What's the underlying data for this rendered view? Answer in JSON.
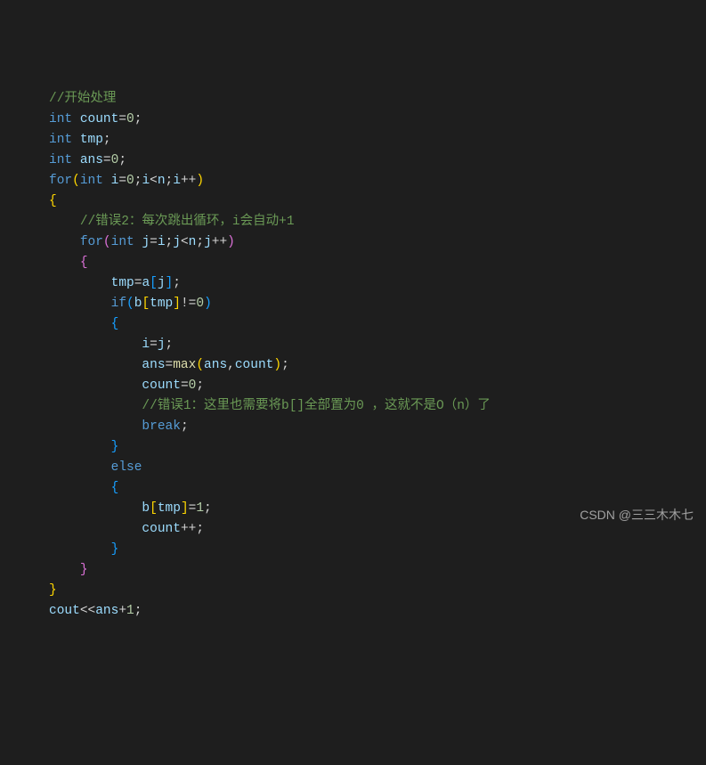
{
  "code": {
    "c1": "//开始处理",
    "l2": {
      "kw": "int",
      "var": "count",
      "eq": "=",
      "num": "0",
      "semi": ";"
    },
    "l3": {
      "kw": "int",
      "var": "tmp",
      "semi": ";"
    },
    "l4": {
      "kw": "int",
      "var": "ans",
      "eq": "=",
      "num": "0",
      "semi": ";"
    },
    "l5": {
      "kw1": "for",
      "lp": "(",
      "kw2": "int",
      "var": "i",
      "eq": "=",
      "num0": "0",
      "s1": ";",
      "var2": "i",
      "lt": "<",
      "var3": "n",
      "s2": ";",
      "var4": "i",
      "inc": "++",
      "rp": ")"
    },
    "l6": "{",
    "c2": "//错误2：每次跳出循环，i会自动+1",
    "l8": {
      "kw1": "for",
      "lp": "(",
      "kw2": "int",
      "var": "j",
      "eq": "=",
      "var2": "i",
      "s1": ";",
      "var3": "j",
      "lt": "<",
      "var4": "n",
      "s2": ";",
      "var5": "j",
      "inc": "++",
      "rp": ")"
    },
    "l9": "{",
    "l10": {
      "var1": "tmp",
      "eq": "=",
      "var2": "a",
      "lb": "[",
      "var3": "j",
      "rb": "]",
      "semi": ";"
    },
    "l11": {
      "kw": "if",
      "lp": "(",
      "var1": "b",
      "lb": "[",
      "var2": "tmp",
      "rb": "]",
      "neq": "!=",
      "num": "0",
      "rp": ")"
    },
    "l12": "{",
    "l13": {
      "var1": "i",
      "eq": "=",
      "var2": "j",
      "semi": ";"
    },
    "l14": {
      "var1": "ans",
      "eq": "=",
      "fn": "max",
      "lp": "(",
      "var2": "ans",
      "comma": ",",
      "var3": "count",
      "rp": ")",
      "semi": ";"
    },
    "l15": {
      "var": "count",
      "eq": "=",
      "num": "0",
      "semi": ";"
    },
    "c3": "//错误1：这里也需要将b[]全部置为0 ，这就不是O（n）了",
    "l17": {
      "kw": "break",
      "semi": ";"
    },
    "l18": "}",
    "l19": {
      "kw": "else"
    },
    "l20": "{",
    "l21": {
      "var1": "b",
      "lb": "[",
      "var2": "tmp",
      "rb": "]",
      "eq": "=",
      "num": "1",
      "semi": ";"
    },
    "l22": {
      "var": "count",
      "inc": "++",
      "semi": ";"
    },
    "l23": "}",
    "l24": "}",
    "l25": "}",
    "l26": {
      "var1": "cout",
      "op": "<<",
      "var2": "ans",
      "plus": "+",
      "num": "1",
      "semi": ";"
    }
  },
  "watermark": "CSDN @三三木木七",
  "chart_data": {
    "type": "code",
    "language": "cpp",
    "source": "//开始处理\nint count=0;\nint tmp;\nint ans=0;\nfor(int i=0;i<n;i++)\n{\n    //错误2：每次跳出循环，i会自动+1\n    for(int j=i;j<n;j++)\n    {\n        tmp=a[j];\n        if(b[tmp]!=0)\n        {\n            i=j;\n            ans=max(ans,count);\n            count=0;\n            //错误1：这里也需要将b[]全部置为0 ，这就不是O（n）了\n            break;\n        }\n        else\n        {\n            b[tmp]=1;\n            count++;\n        }\n    }\n}\ncout<<ans+1;"
  }
}
